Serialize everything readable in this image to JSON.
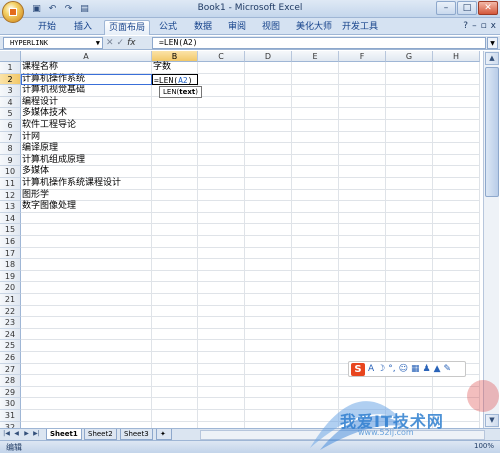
{
  "window": {
    "title": "Book1 - Microsoft Excel"
  },
  "qat": {
    "icons": [
      "save-icon",
      "undo-icon",
      "redo-icon",
      "print-icon"
    ]
  },
  "tabs": [
    {
      "label": "开始"
    },
    {
      "label": "插入"
    },
    {
      "label": "页面布局"
    },
    {
      "label": "公式"
    },
    {
      "label": "数据"
    },
    {
      "label": "审阅"
    },
    {
      "label": "视图"
    },
    {
      "label": "美化大师"
    },
    {
      "label": "开发工具"
    }
  ],
  "active_tab": "页面布局",
  "formula_bar": {
    "name_box": "HYPERLINK",
    "formula": "=LEN(A2)"
  },
  "columns": [
    "A",
    "B",
    "C",
    "D",
    "E",
    "F",
    "G",
    "H"
  ],
  "rows": [
    "1",
    "2",
    "3",
    "4",
    "5",
    "6",
    "7",
    "8",
    "9",
    "10",
    "11",
    "12",
    "13",
    "14",
    "15",
    "16",
    "17",
    "18",
    "19",
    "20",
    "21",
    "22",
    "23",
    "24",
    "25",
    "26",
    "27",
    "28",
    "29",
    "30",
    "31",
    "32"
  ],
  "cells": {
    "A1": "课程名称",
    "B1": "字数",
    "A2": "计算机操作系统",
    "B2": "=LEN(A2)",
    "A3": "计算机视觉基础",
    "A4": "编程设计",
    "A5": "多媒体技术",
    "A6": "软件工程导论",
    "A7": "计网",
    "A8": "编译原理",
    "A9": "计算机组成原理",
    "A10": "多媒体",
    "A11": "计算机操作系统课程设计",
    "A12": "图形学",
    "A13": "数字图像处理"
  },
  "formula_parts": {
    "prefix": "=LEN(",
    "ref": "A2",
    "suffix": ")"
  },
  "tooltip": {
    "fn": "LEN(",
    "arg": "text",
    "close": ")"
  },
  "sheets": [
    "Sheet1",
    "Sheet2",
    "Sheet3"
  ],
  "active_sheet": "Sheet1",
  "status": {
    "mode": "编辑",
    "zoom": "100%"
  },
  "ime": {
    "label": "S"
  },
  "watermark": {
    "text": "我爱IT技术网",
    "url": "www.52ij.com"
  }
}
